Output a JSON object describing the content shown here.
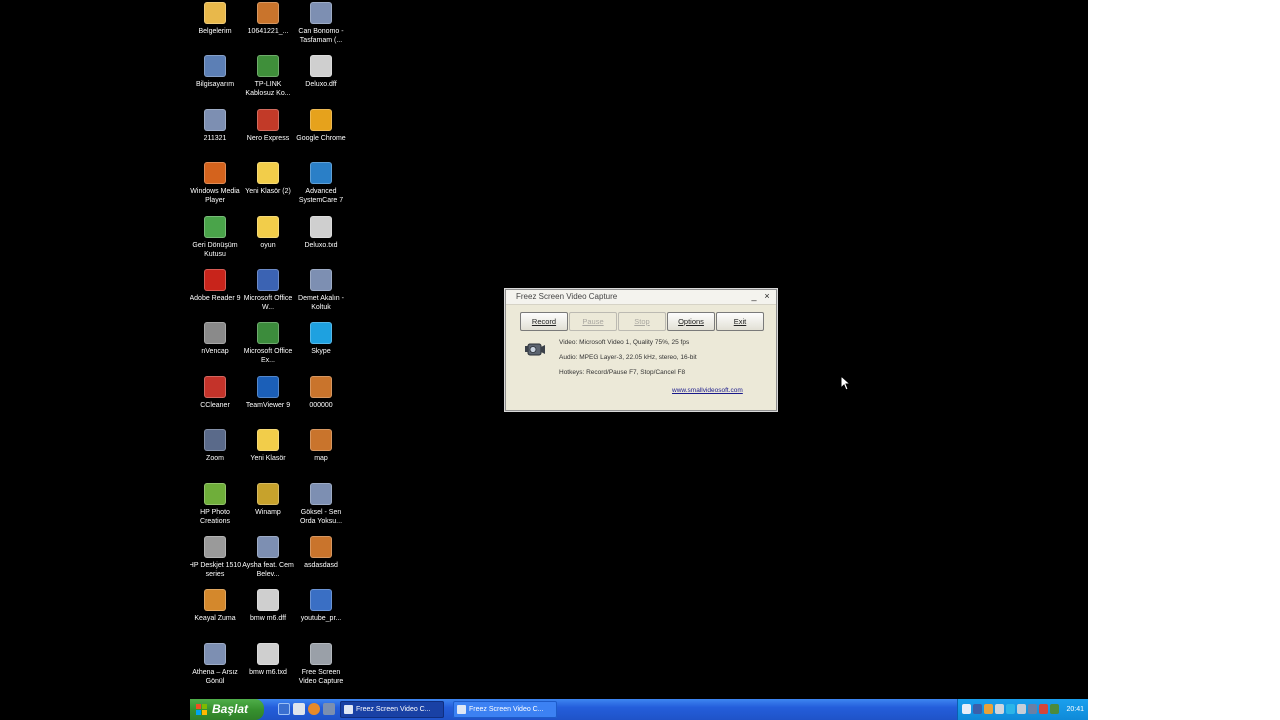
{
  "desktop": {
    "icons": [
      {
        "label": "Belgelerim",
        "icon": "folder-documents-icon",
        "color": "#e8b84b",
        "g": "",
        "name": "desktop-icon-belgelerim"
      },
      {
        "label": "10641221_...",
        "icon": "image-file-icon",
        "color": "#c9742c",
        "g": "",
        "name": "desktop-icon-10641221"
      },
      {
        "label": "Can Bonomo - Tasfamam (...",
        "icon": "media-file-icon",
        "color": "#7d8fb2",
        "g": "",
        "name": "desktop-icon-can-bonomo"
      },
      {
        "label": "Bilgisayarım",
        "icon": "computer-icon",
        "color": "#5c7fb5",
        "g": "",
        "name": "desktop-icon-bilgisayarim"
      },
      {
        "label": "TP-LINK Kablosuz Ko...",
        "icon": "wireless-utility-icon",
        "color": "#3f8f3a",
        "g": "",
        "name": "desktop-icon-tp-link"
      },
      {
        "label": "Deluxo.dff",
        "icon": "document-file-icon",
        "color": "#cfcfcf",
        "g": "",
        "name": "desktop-icon-deluxo-dff"
      },
      {
        "label": "211321",
        "icon": "media-file-icon",
        "color": "#7d8fb2",
        "g": "",
        "name": "desktop-icon-211321"
      },
      {
        "label": "Nero Express",
        "icon": "nero-express-icon",
        "color": "#c23a28",
        "g": "",
        "name": "desktop-icon-nero-express"
      },
      {
        "label": "Google Chrome",
        "icon": "chrome-icon",
        "color": "#e6a21c",
        "g": "",
        "name": "desktop-icon-google-chrome"
      },
      {
        "label": "Windows Media Player",
        "icon": "media-player-icon",
        "color": "#d4631d",
        "g": "",
        "name": "desktop-icon-windows-media-player"
      },
      {
        "label": "Yeni Klasör (2)",
        "icon": "folder-icon",
        "color": "#f2cd4a",
        "g": "",
        "name": "desktop-icon-yeni-klasor-2"
      },
      {
        "label": "Advanced SystemCare 7",
        "icon": "systemcare-icon",
        "color": "#2a7fc7",
        "g": "",
        "name": "desktop-icon-advanced-systemcare"
      },
      {
        "label": "Geri Dönüşüm Kutusu",
        "icon": "recycle-bin-icon",
        "color": "#4aa44a",
        "g": "",
        "name": "desktop-icon-recycle-bin"
      },
      {
        "label": "oyun",
        "icon": "folder-icon",
        "color": "#f2cd4a",
        "g": "",
        "name": "desktop-icon-oyun"
      },
      {
        "label": "Deluxo.txd",
        "icon": "document-file-icon",
        "color": "#cfcfcf",
        "g": "",
        "name": "desktop-icon-deluxo-txd"
      },
      {
        "label": "Adobe Reader 9",
        "icon": "pdf-reader-icon",
        "color": "#c8241b",
        "g": "",
        "name": "desktop-icon-adobe-reader"
      },
      {
        "label": "Microsoft Office W...",
        "icon": "word-icon",
        "color": "#3b63b3",
        "g": "",
        "name": "desktop-icon-office-word"
      },
      {
        "label": "Demet Akalın - Koltuk",
        "icon": "media-file-icon",
        "color": "#7d8fb2",
        "g": "",
        "name": "desktop-icon-demet-akalin"
      },
      {
        "label": "nVencap",
        "icon": "capture-app-icon",
        "color": "#8a8a8a",
        "g": "",
        "name": "desktop-icon-nvencap"
      },
      {
        "label": "Microsoft Office Ex...",
        "icon": "excel-icon",
        "color": "#3c8c3c",
        "g": "",
        "name": "desktop-icon-office-excel"
      },
      {
        "label": "Skype",
        "icon": "skype-icon",
        "color": "#1ea1e0",
        "g": "",
        "name": "desktop-icon-skype"
      },
      {
        "label": "CCleaner",
        "icon": "ccleaner-icon",
        "color": "#c4332a",
        "g": "",
        "name": "desktop-icon-ccleaner"
      },
      {
        "label": "TeamViewer 9",
        "icon": "teamviewer-icon",
        "color": "#1b5fb8",
        "g": "",
        "name": "desktop-icon-teamviewer"
      },
      {
        "label": "000000",
        "icon": "image-file-icon",
        "color": "#c9742c",
        "g": "",
        "name": "desktop-icon-000000"
      },
      {
        "label": "Zoom",
        "icon": "binoculars-icon",
        "color": "#5a6a8a",
        "g": "",
        "name": "desktop-icon-zoom"
      },
      {
        "label": "Yeni Klasör",
        "icon": "folder-icon",
        "color": "#f2cd4a",
        "g": "",
        "name": "desktop-icon-yeni-klasor"
      },
      {
        "label": "map",
        "icon": "image-file-icon",
        "color": "#c9742c",
        "g": "",
        "name": "desktop-icon-map"
      },
      {
        "label": "HP Photo Creations",
        "icon": "photo-app-icon",
        "color": "#6fae3a",
        "g": "",
        "name": "desktop-icon-hp-photo"
      },
      {
        "label": "Winamp",
        "icon": "winamp-icon",
        "color": "#c7a22c",
        "g": "",
        "name": "desktop-icon-winamp"
      },
      {
        "label": "Göksel - Sen Orda Yoksu...",
        "icon": "media-file-icon",
        "color": "#7d8fb2",
        "g": "",
        "name": "desktop-icon-goksel"
      },
      {
        "label": "HP Deskjet 1510 series",
        "icon": "printer-icon",
        "color": "#9a9a9a",
        "g": "",
        "name": "desktop-icon-hp-deskjet"
      },
      {
        "label": "Aysha feat. Cem Belev...",
        "icon": "media-file-icon",
        "color": "#7d8fb2",
        "g": "",
        "name": "desktop-icon-aysha"
      },
      {
        "label": "asdasdasd",
        "icon": "image-file-icon",
        "color": "#c9742c",
        "g": "",
        "name": "desktop-icon-asdasdasd"
      },
      {
        "label": "Keayal Zuma",
        "icon": "game-icon",
        "color": "#d4882c",
        "g": "",
        "name": "desktop-icon-zuma"
      },
      {
        "label": "bmw m6.dff",
        "icon": "document-file-icon",
        "color": "#cfcfcf",
        "g": "",
        "name": "desktop-icon-bmw-dff"
      },
      {
        "label": "youtube_pr...",
        "icon": "image-file-icon",
        "color": "#3a6fc4",
        "g": "",
        "name": "desktop-icon-youtube"
      },
      {
        "label": "Athena – Arsız Gönül",
        "icon": "media-file-icon",
        "color": "#7d8fb2",
        "g": "",
        "name": "desktop-icon-athena"
      },
      {
        "label": "bmw m6.txd",
        "icon": "document-file-icon",
        "color": "#cfcfcf",
        "g": "",
        "name": "desktop-icon-bmw-txd"
      },
      {
        "label": "Free Screen Video Capture",
        "icon": "video-capture-icon",
        "color": "#9aa0a8",
        "g": "",
        "name": "desktop-icon-free-screen-video-capture"
      }
    ]
  },
  "dialog": {
    "title": "Freez Screen Video Capture",
    "buttons": {
      "record": "Record",
      "pause": "Pause",
      "stop": "Stop",
      "options": "Options",
      "exit": "Exit"
    },
    "video_info": "Video: Microsoft Video 1, Quality 75%, 25 fps",
    "audio_info": "Audio: MPEG Layer-3, 22.05 kHz, stereo, 16-bit",
    "hotkeys_info": "Hotkeys: Record/Pause F7, Stop/Cancel F8",
    "link": "www.smallvideosoft.com"
  },
  "taskbar": {
    "start_label": "Başlat",
    "tasks": [
      {
        "label": "Freez Screen Video C...",
        "active": true
      },
      {
        "label": "Freez Screen Video C...",
        "active": false
      }
    ],
    "clock": "20:41"
  },
  "colors": {
    "desktop_bg": "#000000",
    "taskbar_blue": "#245edb",
    "start_green": "#37922f",
    "tray_blue": "#0f8ad8",
    "dialog_bg": "#ece9d8"
  }
}
